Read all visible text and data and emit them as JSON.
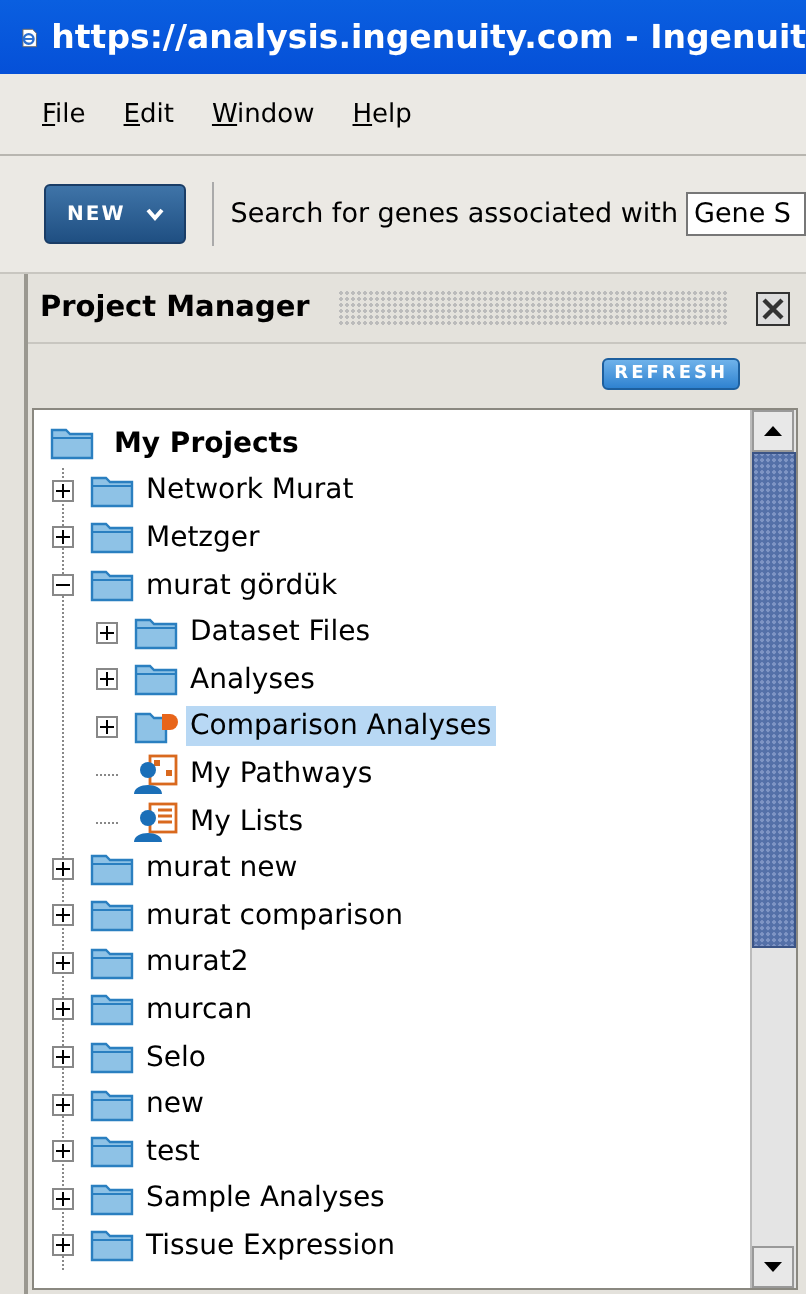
{
  "window": {
    "title": "https://analysis.ingenuity.com - Ingenuit"
  },
  "menu": [
    "File",
    "Edit",
    "Window",
    "Help"
  ],
  "toolbar": {
    "new_button": "NEW",
    "search_label": "Search for genes associated with",
    "search_value": "Gene S"
  },
  "panel": {
    "title": "Project Manager",
    "refresh_button": "REFRESH"
  },
  "tree": {
    "root": {
      "label": "My Projects",
      "selected": false
    },
    "items": [
      {
        "label": "Network Murat",
        "kind": "folder",
        "expanded": false,
        "selected": false
      },
      {
        "label": "Metzger",
        "kind": "folder",
        "expanded": false,
        "selected": false
      },
      {
        "label": "murat gördük",
        "kind": "folder",
        "expanded": true,
        "selected": false,
        "children": [
          {
            "label": "Dataset Files",
            "kind": "folder",
            "expanded": false,
            "selected": false
          },
          {
            "label": "Analyses",
            "kind": "folder",
            "expanded": false,
            "selected": false
          },
          {
            "label": "Comparison Analyses",
            "kind": "comparison",
            "expanded": false,
            "selected": true
          },
          {
            "label": "My Pathways",
            "kind": "pathways",
            "selected": false
          },
          {
            "label": "My Lists",
            "kind": "lists",
            "selected": false
          }
        ]
      },
      {
        "label": "murat new",
        "kind": "folder",
        "expanded": false,
        "selected": false
      },
      {
        "label": "murat comparison",
        "kind": "folder",
        "expanded": false,
        "selected": false
      },
      {
        "label": "murat2",
        "kind": "folder",
        "expanded": false,
        "selected": false
      },
      {
        "label": "murcan",
        "kind": "folder",
        "expanded": false,
        "selected": false
      },
      {
        "label": "Selo",
        "kind": "folder",
        "expanded": false,
        "selected": false
      },
      {
        "label": "new",
        "kind": "folder",
        "expanded": false,
        "selected": false
      },
      {
        "label": "test",
        "kind": "folder",
        "expanded": false,
        "selected": false
      },
      {
        "label": "Sample Analyses",
        "kind": "folder",
        "expanded": false,
        "selected": false
      },
      {
        "label": "Tissue Expression",
        "kind": "folder",
        "expanded": false,
        "selected": false
      }
    ]
  }
}
